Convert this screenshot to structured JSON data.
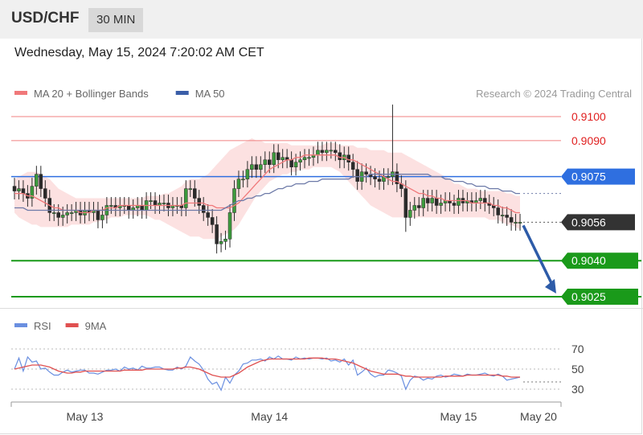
{
  "header": {
    "symbol": "USD/CHF",
    "timeframe": "30 MIN",
    "datetime": "Wednesday, May 15, 2024 7:20:02 AM CET"
  },
  "credit": "Research © 2024 Trading Central",
  "colors": {
    "candle": "#3d9a3d",
    "ma20": "#f0787a",
    "band_fill": "#fcdcdc",
    "ma50": "#6d7aa8",
    "resistance": "#f08080",
    "pivot": "#2f6fe0",
    "support": "#1a9a1a",
    "current": "#333333",
    "arrow": "#2d5ba8",
    "rsi": "#6a8fe0",
    "rsi_ma": "#e05050"
  },
  "chart_data": [
    {
      "type": "line",
      "title": "",
      "legend": [
        {
          "name": "MA 20 + Bollinger Bands",
          "color": "#f0787a"
        },
        {
          "name": "MA 50",
          "color": "#3a5ea8"
        }
      ],
      "legend_position": "top-left",
      "x_axis": {
        "ticks": [
          {
            "label": "May 13",
            "bar": 16
          },
          {
            "label": "May 14",
            "bar": 58
          },
          {
            "label": "May 15",
            "bar": 101
          },
          {
            "label": "May 20",
            "bar": 117
          }
        ]
      },
      "ylim": [
        0.9015,
        0.9105
      ],
      "levels": [
        {
          "value": 0.91,
          "label": "0.9100",
          "type": "resistance"
        },
        {
          "value": 0.909,
          "label": "0.9090",
          "type": "resistance"
        },
        {
          "value": 0.9075,
          "label": "0.9075",
          "type": "pivot"
        },
        {
          "value": 0.9056,
          "label": "0.9056",
          "type": "current"
        },
        {
          "value": 0.904,
          "label": "0.9040",
          "type": "support"
        },
        {
          "value": 0.9025,
          "label": "0.9025",
          "type": "support"
        }
      ],
      "projection": {
        "from_bar": 115,
        "from_value": 0.9056,
        "to_bar": 122,
        "to_value": 0.9025
      },
      "series": [
        {
          "type": "candlestick",
          "close": [
            0.9069,
            0.907,
            0.9068,
            0.9066,
            0.9071,
            0.9076,
            0.907,
            0.9066,
            0.906,
            0.906,
            0.9058,
            0.9059,
            0.906,
            0.906,
            0.9061,
            0.9059,
            0.9061,
            0.906,
            0.9061,
            0.9057,
            0.9059,
            0.9063,
            0.9063,
            0.9062,
            0.9063,
            0.9063,
            0.9061,
            0.9062,
            0.9063,
            0.9061,
            0.9065,
            0.9065,
            0.9063,
            0.9064,
            0.9064,
            0.9062,
            0.9063,
            0.9063,
            0.9062,
            0.907,
            0.907,
            0.9066,
            0.9063,
            0.906,
            0.9058,
            0.9055,
            0.9047,
            0.9048,
            0.9049,
            0.906,
            0.907,
            0.9074,
            0.9074,
            0.9078,
            0.908,
            0.9078,
            0.908,
            0.9082,
            0.908,
            0.9085,
            0.9082,
            0.9083,
            0.9082,
            0.9079,
            0.9081,
            0.9082,
            0.9083,
            0.9083,
            0.9084,
            0.9086,
            0.9085,
            0.9086,
            0.9086,
            0.9085,
            0.9082,
            0.9084,
            0.9081,
            0.9078,
            0.9073,
            0.9077,
            0.9076,
            0.9075,
            0.9074,
            0.9073,
            0.9075,
            0.9075,
            0.9077,
            0.9072,
            0.907,
            0.9058,
            0.9061,
            0.9063,
            0.9062,
            0.9066,
            0.9064,
            0.9066,
            0.9063,
            0.9064,
            0.9065,
            0.9064,
            0.9063,
            0.9066,
            0.9064,
            0.9065,
            0.9064,
            0.9065,
            0.9066,
            0.9064,
            0.9063,
            0.9062,
            0.9059,
            0.9059,
            0.9058,
            0.9056,
            0.9056,
            0.9056
          ]
        },
        {
          "name": "MA 20",
          "values": [
            0.9068,
            0.9068,
            0.9068,
            0.9067,
            0.9067,
            0.9066,
            0.9065,
            0.9064,
            0.9063,
            0.9062,
            0.9062,
            0.9061,
            0.9061,
            0.9061,
            0.9061,
            0.906,
            0.906,
            0.906,
            0.9061,
            0.9061,
            0.9061,
            0.9062,
            0.9062,
            0.9062,
            0.9063,
            0.9063,
            0.9063,
            0.9063,
            0.9063,
            0.9063,
            0.9063,
            0.9063,
            0.9063,
            0.9063,
            0.9063,
            0.9063,
            0.9063,
            0.9063,
            0.9063,
            0.9064,
            0.9064,
            0.9064,
            0.9064,
            0.9064,
            0.9063,
            0.9063,
            0.9062,
            0.9062,
            0.9062,
            0.9062,
            0.9063,
            0.9064,
            0.9066,
            0.9068,
            0.907,
            0.9072,
            0.9074,
            0.9076,
            0.9078,
            0.9079,
            0.908,
            0.9081,
            0.9082,
            0.9082,
            0.9083,
            0.9083,
            0.9084,
            0.9084,
            0.9084,
            0.9084,
            0.9084,
            0.9084,
            0.9084,
            0.9084,
            0.9083,
            0.9083,
            0.9082,
            0.9082,
            0.9081,
            0.908,
            0.9079,
            0.9078,
            0.9077,
            0.9076,
            0.9075,
            0.9074,
            0.9073,
            0.9073,
            0.9072,
            0.9071,
            0.907,
            0.9069,
            0.9068,
            0.9068,
            0.9067,
            0.9067,
            0.9066,
            0.9066,
            0.9065,
            0.9065,
            0.9065,
            0.9065,
            0.9065,
            0.9065,
            0.9064,
            0.9064,
            0.9064,
            0.9064,
            0.9064,
            0.9063,
            0.9063,
            0.9062,
            0.9062,
            0.9061,
            0.906,
            0.906
          ]
        },
        {
          "name": "Bollinger Upper",
          "values": [
            0.9074,
            0.9075,
            0.9076,
            0.9077,
            0.9077,
            0.9077,
            0.9076,
            0.9075,
            0.9074,
            0.9072,
            0.907,
            0.9069,
            0.9068,
            0.9067,
            0.9066,
            0.9066,
            0.9066,
            0.9066,
            0.9066,
            0.9066,
            0.9066,
            0.9066,
            0.9066,
            0.9066,
            0.9066,
            0.9066,
            0.9066,
            0.9066,
            0.9066,
            0.9066,
            0.9067,
            0.9067,
            0.9067,
            0.9067,
            0.9068,
            0.9068,
            0.9069,
            0.907,
            0.9071,
            0.9073,
            0.9074,
            0.9074,
            0.9074,
            0.9075,
            0.9076,
            0.9078,
            0.908,
            0.9082,
            0.9084,
            0.9086,
            0.9087,
            0.9088,
            0.9089,
            0.909,
            0.9091,
            0.909,
            0.909,
            0.9089,
            0.9089,
            0.9089,
            0.9089,
            0.9089,
            0.9089,
            0.9088,
            0.9088,
            0.9088,
            0.9088,
            0.9088,
            0.9088,
            0.9088,
            0.9088,
            0.9089,
            0.9089,
            0.9089,
            0.9088,
            0.9088,
            0.9088,
            0.9088,
            0.9087,
            0.9087,
            0.9087,
            0.9086,
            0.9086,
            0.9086,
            0.9086,
            0.9085,
            0.9085,
            0.9085,
            0.9085,
            0.9084,
            0.9083,
            0.9082,
            0.9081,
            0.908,
            0.9079,
            0.9078,
            0.9077,
            0.9076,
            0.9075,
            0.9074,
            0.9072,
            0.9072,
            0.9071,
            0.907,
            0.907,
            0.907,
            0.9069,
            0.9069,
            0.9069,
            0.9069,
            0.9069,
            0.9069,
            0.9068,
            0.9068,
            0.9067,
            0.9067
          ]
        },
        {
          "name": "Bollinger Lower",
          "values": [
            0.906,
            0.9058,
            0.9057,
            0.9056,
            0.9055,
            0.9055,
            0.9054,
            0.9054,
            0.9054,
            0.9054,
            0.9054,
            0.9054,
            0.9054,
            0.9055,
            0.9055,
            0.9055,
            0.9055,
            0.9055,
            0.9056,
            0.9056,
            0.9057,
            0.9057,
            0.9058,
            0.9058,
            0.9058,
            0.9059,
            0.9059,
            0.9059,
            0.9059,
            0.9059,
            0.9059,
            0.9058,
            0.9057,
            0.9057,
            0.9056,
            0.9055,
            0.9054,
            0.9053,
            0.9052,
            0.9051,
            0.905,
            0.905,
            0.905,
            0.9049,
            0.9049,
            0.9049,
            0.9049,
            0.905,
            0.9051,
            0.9052,
            0.9053,
            0.9055,
            0.9058,
            0.9061,
            0.9064,
            0.9067,
            0.9069,
            0.9071,
            0.9073,
            0.9074,
            0.9075,
            0.9076,
            0.9076,
            0.9077,
            0.9077,
            0.9078,
            0.9078,
            0.9078,
            0.9079,
            0.9079,
            0.9079,
            0.9079,
            0.9079,
            0.9078,
            0.9077,
            0.9075,
            0.9073,
            0.9071,
            0.9069,
            0.9067,
            0.9065,
            0.9063,
            0.9062,
            0.9061,
            0.906,
            0.9059,
            0.9058,
            0.9058,
            0.9058,
            0.9058,
            0.9058,
            0.9058,
            0.9058,
            0.9058,
            0.9058,
            0.9058,
            0.9058,
            0.9058,
            0.9058,
            0.9058,
            0.9058,
            0.9058,
            0.9058,
            0.9058,
            0.9058,
            0.9058,
            0.9058,
            0.9058,
            0.9057,
            0.9057,
            0.9057,
            0.9056,
            0.9055,
            0.9055,
            0.9054,
            0.9053
          ]
        },
        {
          "name": "MA 50",
          "values": [
            0.9062,
            0.9062,
            0.9062,
            0.9061,
            0.9061,
            0.9061,
            0.9061,
            0.9061,
            0.9061,
            0.9061,
            0.9061,
            0.9061,
            0.9061,
            0.9061,
            0.9061,
            0.9061,
            0.9061,
            0.9061,
            0.9061,
            0.9061,
            0.9061,
            0.9061,
            0.9061,
            0.9061,
            0.9061,
            0.9061,
            0.9061,
            0.9061,
            0.9061,
            0.9061,
            0.9061,
            0.9061,
            0.9061,
            0.9061,
            0.9061,
            0.9061,
            0.9061,
            0.9061,
            0.9061,
            0.9061,
            0.9061,
            0.9061,
            0.9061,
            0.9061,
            0.9061,
            0.9061,
            0.9061,
            0.9061,
            0.9062,
            0.9063,
            0.9064,
            0.9065,
            0.9065,
            0.9066,
            0.9066,
            0.9067,
            0.9067,
            0.9068,
            0.9068,
            0.9069,
            0.907,
            0.907,
            0.9071,
            0.9071,
            0.9072,
            0.9072,
            0.9072,
            0.9073,
            0.9073,
            0.9073,
            0.9074,
            0.9074,
            0.9074,
            0.9074,
            0.9074,
            0.9074,
            0.9074,
            0.9075,
            0.9075,
            0.9075,
            0.9075,
            0.9076,
            0.9076,
            0.9076,
            0.9076,
            0.9076,
            0.9076,
            0.9076,
            0.9076,
            0.9076,
            0.9076,
            0.9076,
            0.9076,
            0.9076,
            0.9076,
            0.9075,
            0.9075,
            0.9075,
            0.9074,
            0.9074,
            0.9073,
            0.9073,
            0.9073,
            0.9072,
            0.9072,
            0.9071,
            0.9071,
            0.9071,
            0.907,
            0.907,
            0.907,
            0.9069,
            0.9069,
            0.9069,
            0.9068,
            0.9068
          ]
        }
      ]
    },
    {
      "type": "line",
      "title": "",
      "legend": [
        {
          "name": "RSI",
          "color": "#6a8fe0"
        },
        {
          "name": "9MA",
          "color": "#e05050"
        }
      ],
      "legend_position": "top-left",
      "ylim": [
        25,
        75
      ],
      "y_ticks": [
        70,
        50,
        30
      ],
      "reference_lines": [
        70,
        50,
        30
      ],
      "series": [
        {
          "name": "RSI",
          "values": [
            50,
            61,
            48,
            62,
            57,
            58,
            50,
            51,
            47,
            44,
            44,
            47,
            49,
            47,
            48,
            49,
            49,
            46,
            46,
            45,
            47,
            49,
            49,
            50,
            48,
            52,
            50,
            51,
            49,
            53,
            51,
            51,
            52,
            52,
            50,
            49,
            49,
            52,
            50,
            53,
            62,
            58,
            55,
            49,
            40,
            35,
            37,
            29,
            42,
            36,
            44,
            48,
            55,
            56,
            59,
            59,
            60,
            58,
            62,
            60,
            63,
            60,
            60,
            59,
            62,
            60,
            61,
            60,
            61,
            61,
            60,
            61,
            58,
            59,
            57,
            60,
            54,
            59,
            44,
            47,
            51,
            45,
            42,
            44,
            44,
            49,
            48,
            46,
            43,
            30,
            39,
            43,
            42,
            39,
            41,
            40,
            43,
            44,
            42,
            43,
            45,
            44,
            43,
            45,
            44,
            44,
            45,
            46,
            44,
            43,
            45,
            43,
            39,
            40,
            41,
            42
          ]
        },
        {
          "name": "9MA",
          "values": [
            50,
            51,
            52,
            53,
            54,
            54,
            54,
            53,
            52,
            50,
            48,
            47,
            46,
            46,
            47,
            47,
            48,
            48,
            48,
            48,
            48,
            48,
            48,
            48,
            48,
            49,
            49,
            49,
            49,
            49,
            50,
            50,
            50,
            50,
            50,
            50,
            50,
            51,
            51,
            52,
            52,
            51,
            50,
            48,
            46,
            44,
            43,
            42,
            42,
            42,
            44,
            46,
            49,
            52,
            54,
            56,
            58,
            59,
            60,
            60,
            60,
            60,
            60,
            60,
            60,
            60,
            60,
            61,
            61,
            61,
            61,
            60,
            60,
            60,
            59,
            58,
            57,
            56,
            54,
            52,
            50,
            48,
            47,
            46,
            45,
            45,
            45,
            45,
            44,
            43,
            43,
            42,
            42,
            42,
            42,
            42,
            42,
            42,
            43,
            43,
            43,
            43,
            43,
            44,
            44,
            44,
            44,
            44,
            44,
            44,
            44,
            43,
            43,
            42,
            42,
            42
          ]
        }
      ]
    }
  ]
}
